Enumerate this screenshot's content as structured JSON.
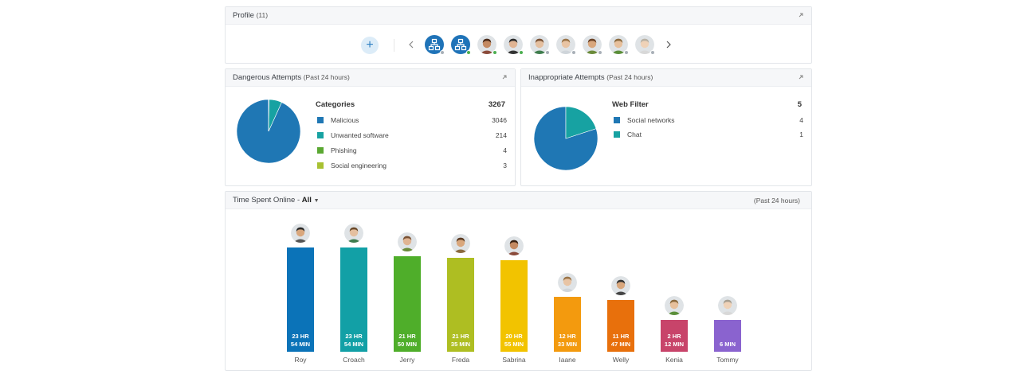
{
  "profile": {
    "title": "Profile",
    "count": "(11)",
    "avatars": [
      {
        "kind": "device",
        "status": "#a9b0b8"
      },
      {
        "kind": "device",
        "status": "#4caf50"
      },
      {
        "kind": "person",
        "skin": "#c48a62",
        "hair": "#4a2a18",
        "shirt": "#8a4a3a",
        "status": "#4caf50"
      },
      {
        "kind": "person",
        "skin": "#e0b493",
        "hair": "#2a2a2a",
        "shirt": "#333",
        "status": "#4caf50"
      },
      {
        "kind": "person",
        "skin": "#e4bf9f",
        "hair": "#7a5234",
        "shirt": "#3f7d4e",
        "status": "#a9b0b8"
      },
      {
        "kind": "person",
        "skin": "#e8c4a4",
        "hair": "#9a7448",
        "shirt": "#cfd5da",
        "status": "#a9b0b8"
      },
      {
        "kind": "person",
        "skin": "#d9a77d",
        "hair": "#6b4226",
        "shirt": "#6b8b3a",
        "status": "#a9b0b8"
      },
      {
        "kind": "person",
        "skin": "#e7c09c",
        "hair": "#8b6a3e",
        "shirt": "#5b8f3a",
        "status": "#a9b0b8"
      },
      {
        "kind": "person",
        "skin": "#efd2b8",
        "hair": "#b9b1a4",
        "shirt": "#d8d8d8",
        "status": "#a9b0b8"
      }
    ]
  },
  "dangerous": {
    "title": "Dangerous Attempts",
    "period": "(Past 24 hours)",
    "legend_title": "Categories",
    "total": "3267",
    "items": [
      {
        "label": "Malicious",
        "value": "3046",
        "color": "#1f77b4"
      },
      {
        "label": "Unwanted software",
        "value": "214",
        "color": "#17a2a2"
      },
      {
        "label": "Phishing",
        "value": "4",
        "color": "#5aa832"
      },
      {
        "label": "Social engineering",
        "value": "3",
        "color": "#a8c132"
      }
    ]
  },
  "inappropriate": {
    "title": "Inappropriate Attempts",
    "period": "(Past 24 hours)",
    "legend_title": "Web Filter",
    "total": "5",
    "items": [
      {
        "label": "Social networks",
        "value": "4",
        "color": "#1f77b4"
      },
      {
        "label": "Chat",
        "value": "1",
        "color": "#17a2a2"
      }
    ]
  },
  "time_online": {
    "title": "Time Spent Online -",
    "filter": "All",
    "period": "(Past 24 hours)"
  },
  "chart_data": {
    "type": "bar",
    "categories": [
      "Roy",
      "Croach",
      "Jerry",
      "Freda",
      "Sabrina",
      "Iaane",
      "Welly",
      "Kenia",
      "Tommy"
    ],
    "values_minutes": [
      1434,
      1434,
      1310,
      1295,
      1255,
      753,
      707,
      132,
      6
    ],
    "labels": [
      [
        "23 HR",
        "54 MIN"
      ],
      [
        "23 HR",
        "54 MIN"
      ],
      [
        "21 HR",
        "50 MIN"
      ],
      [
        "21 HR",
        "35 MIN"
      ],
      [
        "20 HR",
        "55 MIN"
      ],
      [
        "12 HR",
        "33 MIN"
      ],
      [
        "11 HR",
        "47 MIN"
      ],
      [
        "2 HR",
        "12 MIN"
      ],
      [
        "6 MIN"
      ]
    ],
    "colors": [
      "#0b73b8",
      "#12a0a6",
      "#4fae2a",
      "#aebe22",
      "#f2c300",
      "#f39a0e",
      "#e8700c",
      "#c8446a",
      "#8a63cf"
    ],
    "avatars": [
      {
        "skin": "#d9a77d",
        "hair": "#2a2a2a",
        "shirt": "#555"
      },
      {
        "skin": "#e4bf9f",
        "hair": "#6b4a2a",
        "shirt": "#3f7d4e"
      },
      {
        "skin": "#e0b493",
        "hair": "#7a5234",
        "shirt": "#6b8b3a"
      },
      {
        "skin": "#d9a77d",
        "hair": "#5a3a22",
        "shirt": "#8b6a3e"
      },
      {
        "skin": "#c48a62",
        "hair": "#3a2212",
        "shirt": "#8a4a3a"
      },
      {
        "skin": "#e8c4a4",
        "hair": "#9a7448",
        "shirt": "#cfd5da"
      },
      {
        "skin": "#d9a77d",
        "hair": "#333",
        "shirt": "#444"
      },
      {
        "skin": "#e7c09c",
        "hair": "#8b6a3e",
        "shirt": "#5b8f3a"
      },
      {
        "skin": "#efd2b8",
        "hair": "#a79f92",
        "shirt": "#d8d8d8"
      }
    ]
  }
}
